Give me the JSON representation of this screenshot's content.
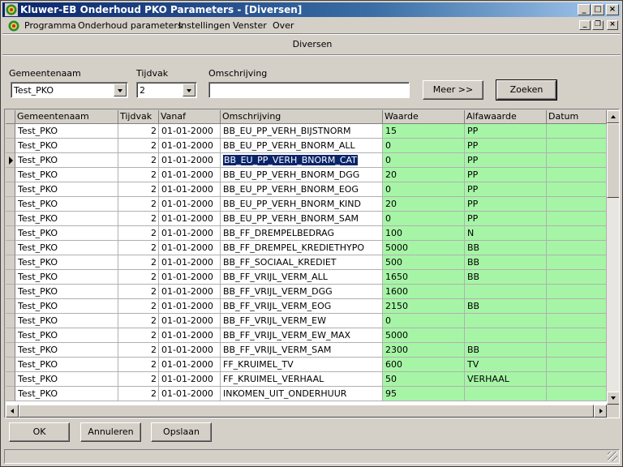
{
  "window": {
    "title": "Kluwer-EB Onderhoud PKO Parameters - [Diversen]",
    "icon": "kluwer-app-icon"
  },
  "menu": [
    {
      "label": "Programma",
      "mnemonic": "P"
    },
    {
      "label": "Onderhoud parameters",
      "mnemonic": "O"
    },
    {
      "label": "Instellingen",
      "mnemonic": "I"
    },
    {
      "label": "Venster",
      "mnemonic": "V"
    },
    {
      "label": "Over",
      "mnemonic": "v"
    }
  ],
  "form_title": "Diversen",
  "filters": {
    "gemeentenaam_label": "Gemeentenaam",
    "gemeentenaam_value": "Test_PKO",
    "tijdvak_label": "Tijdvak",
    "tijdvak_value": "2",
    "omschrijving_label": "Omschrijving",
    "omschrijving_value": "",
    "meer_button": "Meer >>",
    "zoeken_button": "Zoeken"
  },
  "grid": {
    "columns": [
      "Gemeentenaam",
      "Tijdvak",
      "Vanaf",
      "Omschrijving",
      "Waarde",
      "Alfawaarde",
      "Datum"
    ],
    "current_row": 2,
    "rows": [
      [
        "Test_PKO",
        "2",
        "01-01-2000",
        "BB_EU_PP_VERH_BIJSTNORM",
        "15",
        "PP",
        ""
      ],
      [
        "Test_PKO",
        "2",
        "01-01-2000",
        "BB_EU_PP_VERH_BNORM_ALL",
        "0",
        "PP",
        ""
      ],
      [
        "Test_PKO",
        "2",
        "01-01-2000",
        "BB_EU_PP_VERH_BNORM_CAT",
        "0",
        "PP",
        ""
      ],
      [
        "Test_PKO",
        "2",
        "01-01-2000",
        "BB_EU_PP_VERH_BNORM_DGG",
        "20",
        "PP",
        ""
      ],
      [
        "Test_PKO",
        "2",
        "01-01-2000",
        "BB_EU_PP_VERH_BNORM_EOG",
        "0",
        "PP",
        ""
      ],
      [
        "Test_PKO",
        "2",
        "01-01-2000",
        "BB_EU_PP_VERH_BNORM_KIND",
        "20",
        "PP",
        ""
      ],
      [
        "Test_PKO",
        "2",
        "01-01-2000",
        "BB_EU_PP_VERH_BNORM_SAM",
        "0",
        "PP",
        ""
      ],
      [
        "Test_PKO",
        "2",
        "01-01-2000",
        "BB_FF_DREMPELBEDRAG",
        "100",
        "N",
        ""
      ],
      [
        "Test_PKO",
        "2",
        "01-01-2000",
        "BB_FF_DREMPEL_KREDIETHYPO",
        "5000",
        "BB",
        ""
      ],
      [
        "Test_PKO",
        "2",
        "01-01-2000",
        "BB_FF_SOCIAAL_KREDIET",
        "500",
        "BB",
        ""
      ],
      [
        "Test_PKO",
        "2",
        "01-01-2000",
        "BB_FF_VRIJL_VERM_ALL",
        "1650",
        "BB",
        ""
      ],
      [
        "Test_PKO",
        "2",
        "01-01-2000",
        "BB_FF_VRIJL_VERM_DGG",
        "1600",
        "",
        ""
      ],
      [
        "Test_PKO",
        "2",
        "01-01-2000",
        "BB_FF_VRIJL_VERM_EOG",
        "2150",
        "BB",
        ""
      ],
      [
        "Test_PKO",
        "2",
        "01-01-2000",
        "BB_FF_VRIJL_VERM_EW",
        "0",
        "",
        ""
      ],
      [
        "Test_PKO",
        "2",
        "01-01-2000",
        "BB_FF_VRIJL_VERM_EW_MAX",
        "5000",
        "",
        ""
      ],
      [
        "Test_PKO",
        "2",
        "01-01-2000",
        "BB_FF_VRIJL_VERM_SAM",
        "2300",
        "BB",
        ""
      ],
      [
        "Test_PKO",
        "2",
        "01-01-2000",
        "FF_KRUIMEL_TV",
        "600",
        "TV",
        ""
      ],
      [
        "Test_PKO",
        "2",
        "01-01-2000",
        "FF_KRUIMEL_VERHAAL",
        "50",
        "VERHAAL",
        ""
      ],
      [
        "Test_PKO",
        "2",
        "01-01-2000",
        "INKOMEN_UIT_ONDERHUUR",
        "95",
        "",
        ""
      ]
    ]
  },
  "buttons": {
    "ok": "OK",
    "annuleren": "Annuleren",
    "opslaan": "Opslaan"
  },
  "colors": {
    "editable_cell": "#a6f5a6",
    "selection": "#0a246a",
    "titlebar": "#0a246a"
  }
}
